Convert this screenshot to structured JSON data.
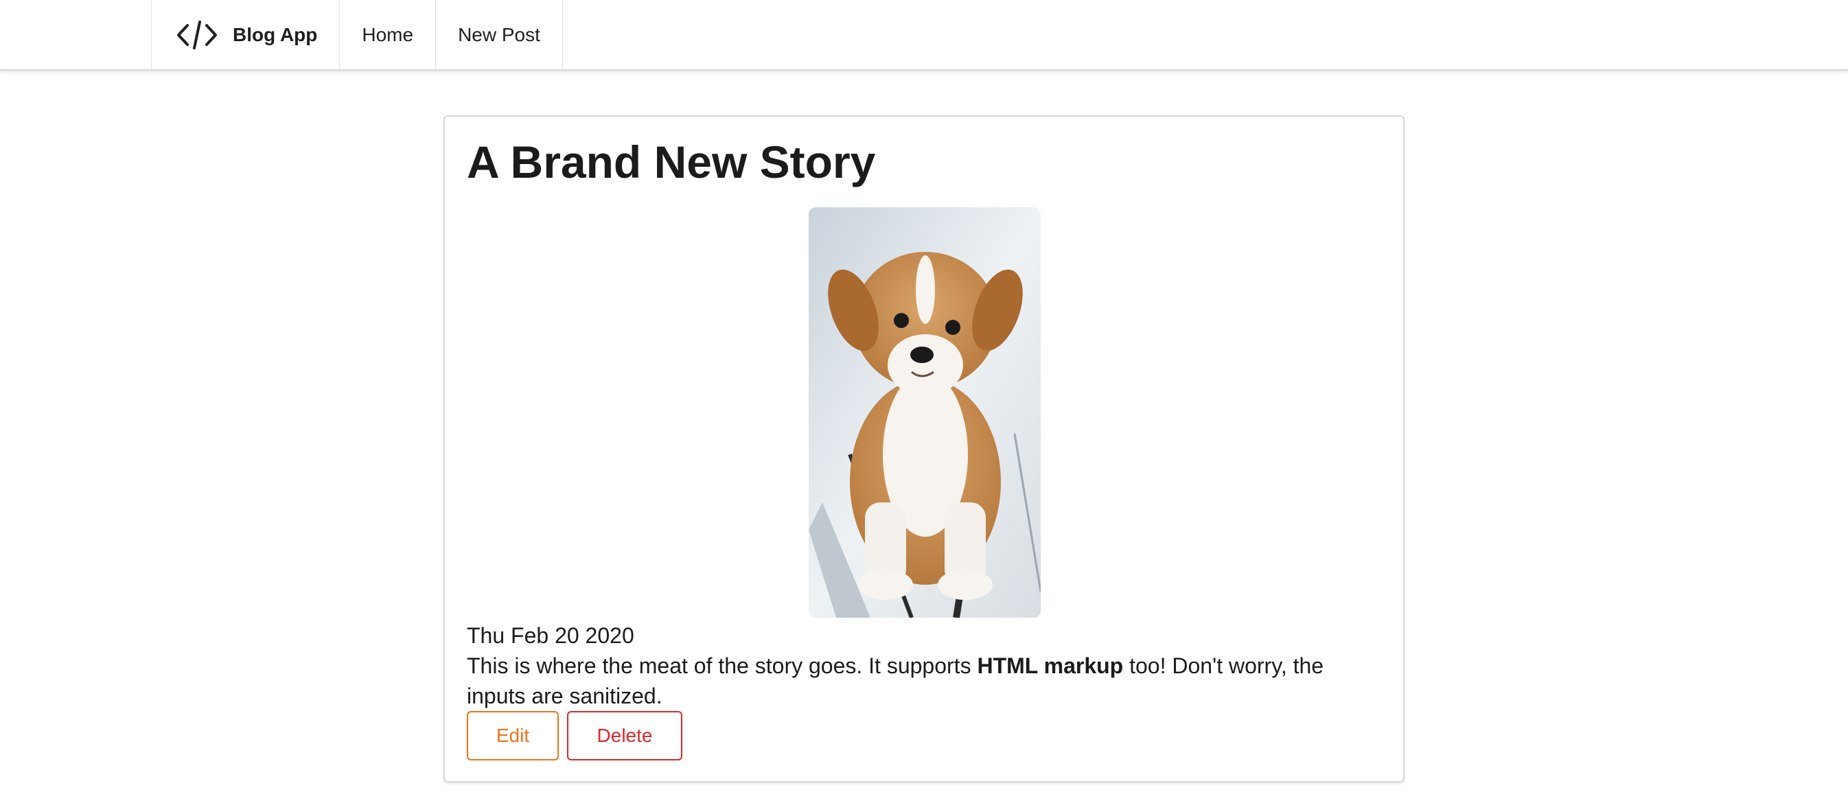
{
  "nav": {
    "brand_label": "Blog App",
    "brand_icon": "code-icon",
    "items": [
      {
        "label": "Home"
      },
      {
        "label": "New Post"
      }
    ]
  },
  "post": {
    "title": "A Brand New Story",
    "image_subject": "puppy-photo",
    "date": "Thu Feb 20 2020",
    "body_before": "This is where the meat of the story goes. It supports ",
    "body_bold": "HTML markup",
    "body_after": " too! Don't worry, the inputs are sanitized."
  },
  "actions": {
    "edit_label": "Edit",
    "delete_label": "Delete"
  },
  "colors": {
    "edit": "#f2711c",
    "delete": "#db2828",
    "border": "#d9d9d9"
  }
}
